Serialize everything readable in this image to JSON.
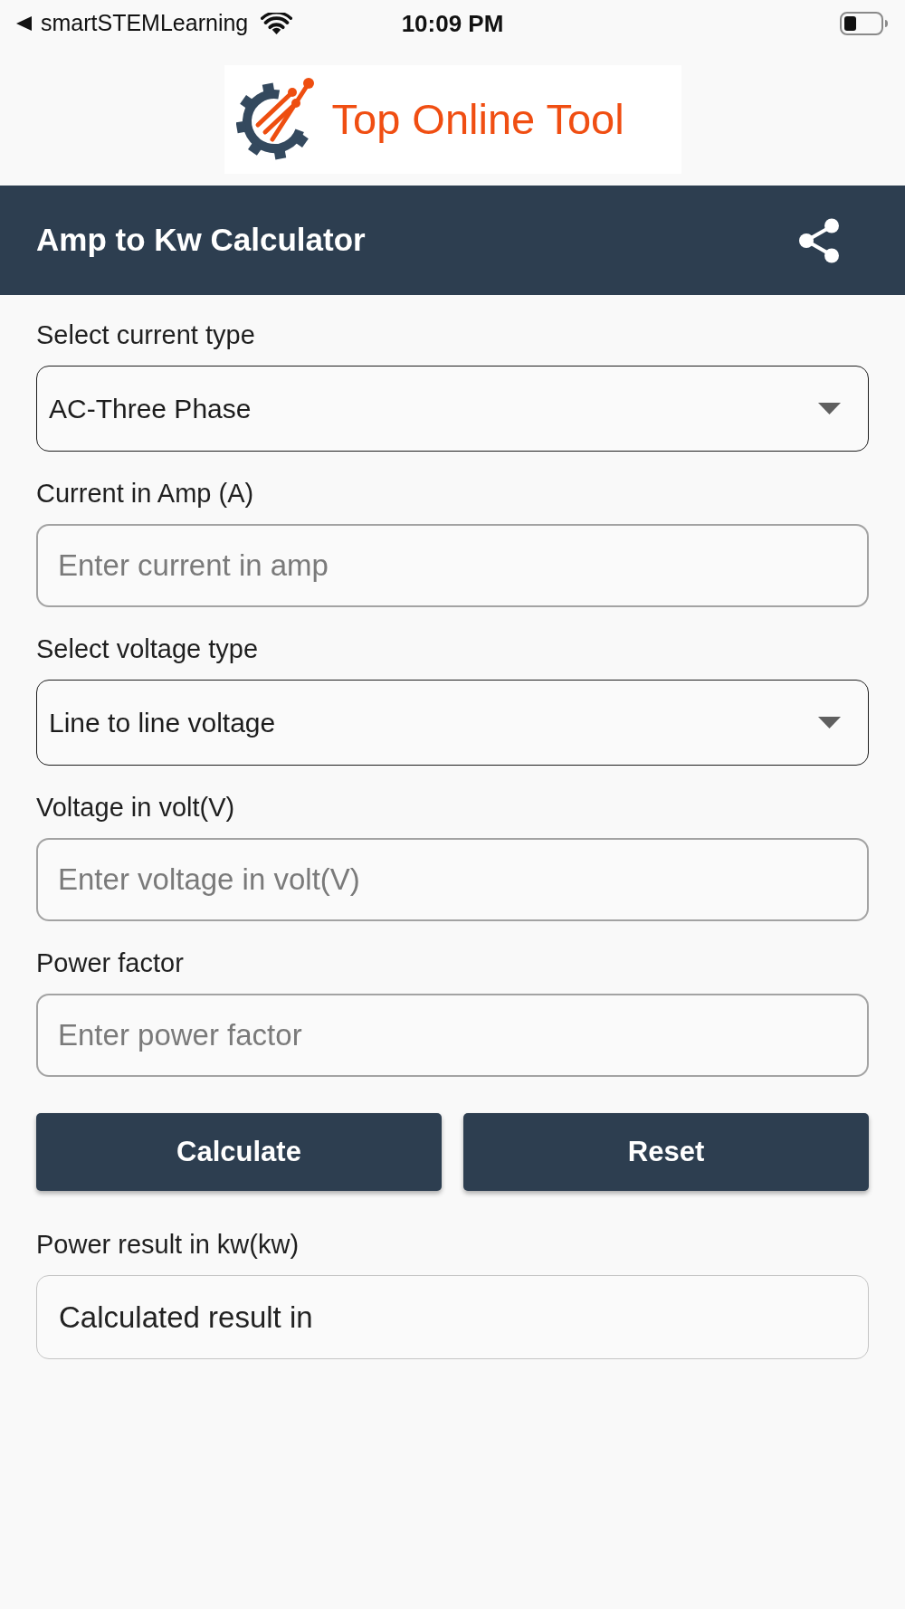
{
  "status_bar": {
    "back_app": "smartSTEMLearning",
    "time": "10:09 PM"
  },
  "logo": {
    "text": "Top Online Tool"
  },
  "app_bar": {
    "title": "Amp to Kw Calculator"
  },
  "form": {
    "fields": [
      {
        "kind": "select",
        "label": "Select current type",
        "value": "AC-Three Phase"
      },
      {
        "kind": "input",
        "label": "Current in Amp (A)",
        "placeholder": "Enter current in amp"
      },
      {
        "kind": "select",
        "label": "Select voltage type",
        "value": "Line to line voltage"
      },
      {
        "kind": "input",
        "label": "Voltage in volt(V)",
        "placeholder": "Enter voltage in volt(V)"
      },
      {
        "kind": "input",
        "label": "Power factor",
        "placeholder": "Enter power factor"
      }
    ]
  },
  "buttons": [
    {
      "label": "Calculate"
    },
    {
      "label": "Reset"
    }
  ],
  "result": {
    "label": "Power result in kw(kw)",
    "value": "Calculated result in"
  }
}
